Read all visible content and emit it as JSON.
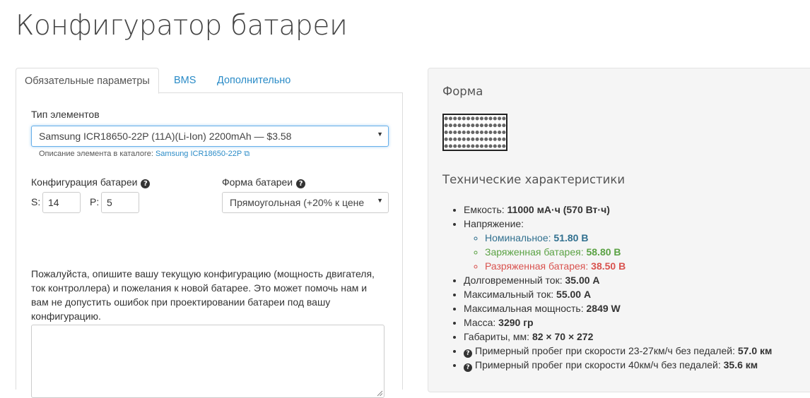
{
  "page": {
    "title": "Конфигуратор батареи"
  },
  "tabs": [
    {
      "label": "Обязательные параметры",
      "active": true
    },
    {
      "label": "BMS",
      "active": false
    },
    {
      "label": "Дополнительно",
      "active": false
    }
  ],
  "form": {
    "cell_type": {
      "label": "Тип элементов",
      "selected": "Samsung ICR18650-22P (11A)(Li-Ion) 2200mAh — $3.58",
      "catalog_prefix": "Описание элемента в каталоге:",
      "catalog_link": "Samsung ICR18650-22P"
    },
    "config": {
      "label": "Конфигурация батареи",
      "s_label": "S:",
      "s_value": "14",
      "p_label": "P:",
      "p_value": "5"
    },
    "shape": {
      "label": "Форма батареи",
      "selected": "Прямоугольная (+20% к цене"
    },
    "description": "Пожалуйста, опишите вашу текущую конфигурацию (мощность двигателя, ток контроллера) и пожелания к новой батарее. Это может помочь нам и вам не допустить ошибок при проектировании батареи под вашу конфигурацию.",
    "notes_value": ""
  },
  "shape_panel": {
    "title": "Форма",
    "rows": 5,
    "cols": 14
  },
  "specs": {
    "title": "Технические характеристики",
    "capacity": {
      "label": "Емкость:",
      "value": "11000 мА·ч (570 Вт·ч)"
    },
    "voltage": {
      "label": "Напряжение:",
      "nominal": {
        "label": "Номинальное:",
        "value": "51.80 В"
      },
      "charged": {
        "label": "Заряженная батарея:",
        "value": "58.80 В"
      },
      "discharged": {
        "label": "Разряженная батарея:",
        "value": "38.50 В"
      }
    },
    "continuous_current": {
      "label": "Долговременный ток:",
      "value": "35.00 А"
    },
    "max_current": {
      "label": "Максимальный ток:",
      "value": "55.00 А"
    },
    "max_power": {
      "label": "Максимальная мощность:",
      "value": "2849 W"
    },
    "mass": {
      "label": "Масса:",
      "value": "3290 гр"
    },
    "dimensions": {
      "label": "Габариты, мм:",
      "value": "82 × 70 × 272"
    },
    "range_pedal": {
      "label": "Примерный пробег при скорости 23-27км/ч без педалей:",
      "value": "57.0 км"
    },
    "range_fast": {
      "label": "Примерный пробег при скорости 40км/ч без педалей:",
      "value": "35.6 км"
    }
  },
  "colors": {
    "link": "#2a8bc7",
    "nominal": "#31708f",
    "charged": "#5ba244",
    "discharged": "#d9534f"
  }
}
